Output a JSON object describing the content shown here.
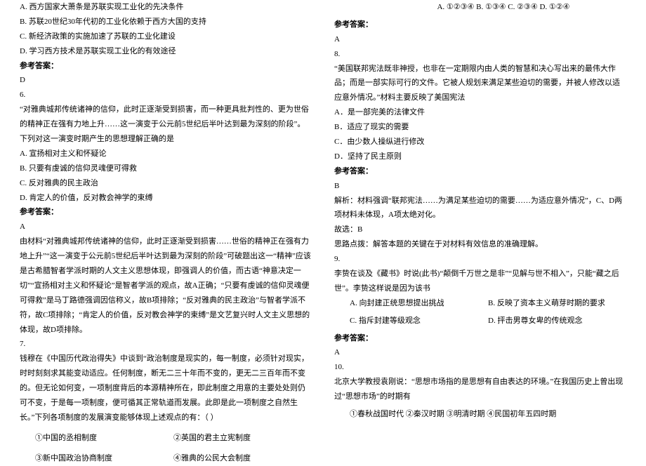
{
  "left": {
    "q5": {
      "optA": "A. 西方国家大萧条是苏联实现工业化的先决条件",
      "optB": "B. 苏联20世纪30年代初的工业化依赖于西方大国的支持",
      "optC": "C. 新经济政策的实施加速了苏联的工业化建设",
      "optD": "D. 学习西方技术是苏联实现工业化的有效途径",
      "ansLabel": "参考答案：",
      "ans": "D"
    },
    "q6": {
      "num": "6.",
      "stem": "“对雅典城邦传统诸神的信仰，此时正逐渐受到损害，而一种更具批判性的、更为世俗的精神正在强有力地上升……这一演变于公元前5世纪后半叶达到最为深刻的阶段”。下列对这一演变时期产生的思想理解正确的是",
      "optA": "A. 宣扬相对主义和怀疑论",
      "optB": "B. 只要有虔诚的信仰灵魂便可得救",
      "optC": "C. 反对雅典的民主政治",
      "optD": "D. 肯定人的价值，反对教会神学的束缚",
      "ansLabel": "参考答案：",
      "ans": "A",
      "explain": "由材料“对雅典城邦传统诸神的信仰，此时正逐渐受到损害……世俗的精神正在强有力地上升”“这一演变于公元前5世纪后半叶达到最为深刻的阶段”可破题出这一“精神”应该是古希腊智者学派时期的人文主义思想体现，即强调人的价值，而古语“神意决定一切”“宣扬相对主义和怀疑论”是智者学派的观点，故A正确；“只要有虔诚的信仰灵魂便可得救”是马丁路德强调因信称义，故B项排除；“反对雅典的民主政治”与智者学派不符，故C项排除；“肯定人的价值，反对教会神学的束缚”是文艺复兴时人文主义思想的体现，故D项排除。"
    },
    "q7": {
      "num": "7.",
      "stem": "钱穆在《中国历代政治得失》中谈到“政治制度是现实的，每一制度，必须针对现实，时时刻刻求其能变动适应。任何制度，断无二三十年而不变的，更无二三百年而不变的。但无论如何变，一项制度背后的本源精神所在，即此制度之用意的主要处处则仍可不变，于是每一项制度，便可循其正常轨道而发展。此即是此一项制度之自然生长。”下列各项制度的发展演变能够体现上述观点的有：（   ）",
      "opt1": "①中国的丞相制度",
      "opt2": "②英国的君主立宪制度",
      "opt3": "③新中国政治协商制度",
      "opt4": "④雅典的公民大会制度"
    }
  },
  "right": {
    "q7opts": "A. ①②③④  B. ①③④    C. ②③④    D. ①②④",
    "q7ansLabel": "参考答案：",
    "q7ans": "A",
    "q8": {
      "num": "8.",
      "stem": "“美国联邦宪法既非神授，也非在一定期限内由人类的智慧和决心写出来的最伟大作品；而是一部实际可行的文件。它被人规划来满足某些迫切的需要，并被人修改以适应意外情况。”材料主要反映了美国宪法",
      "optA": "A．是一部完美的法律文件",
      "optB": "B．适应了现实的需要",
      "optC": "C．由少数人操纵进行修改",
      "optD": "D．坚持了民主原则",
      "ansLabel": "参考答案：",
      "ans": "B",
      "explain1": "解析：材料强调“联邦宪法……为满足某些迫切的需要……为适应意外情况”，C、D两项材料未体现，A项太绝对化。",
      "explain2": "故选：B",
      "explain3": "思路点拨：解答本题的关键在于对材料有效信息的准确理解。"
    },
    "q9": {
      "num": "9.",
      "stem": "李贽在谈及《藏书》时说(此书)“颠倒千万世之是非”“见解与世不相入”，只能“藏之后世”。李贽这样说是因为该书",
      "optA": "A. 向封建正统思想提出挑战",
      "optB": "B. 反映了资本主义萌芽时期的要求",
      "optC": "C. 指斥封建等级观念",
      "optD": "D. 抨击男尊女卑的传统观念",
      "ansLabel": "参考答案：",
      "ans": "A"
    },
    "q10": {
      "num": "10.",
      "stem": "北京大学教授袁刚说：“思想市场指的是思想有自由表达的环境。”在我国历史上曾出现过“思想市场”的时期有",
      "opts": "①春秋战国时代    ②秦汉时期    ③明清时期    ④民国初年五四时期"
    }
  }
}
